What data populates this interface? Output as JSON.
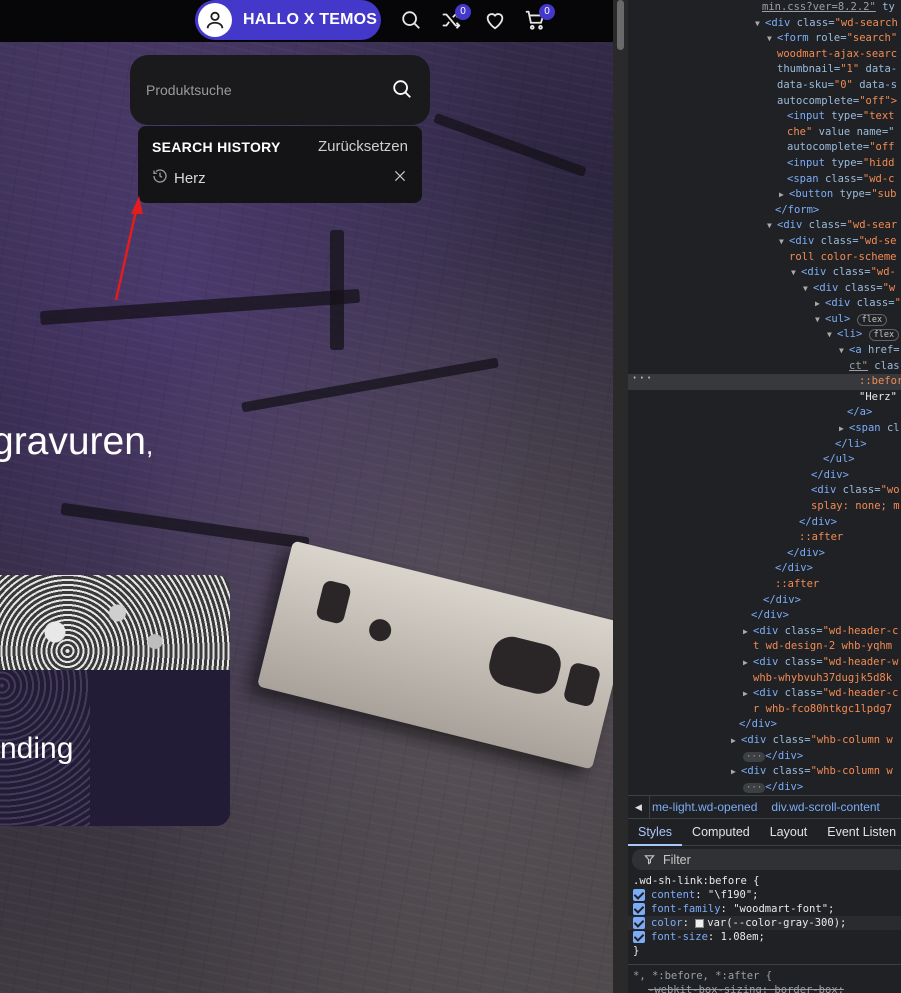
{
  "site": {
    "account": {
      "label": "HALLO X TEMOS"
    },
    "compare_count": "0",
    "cart_count": "0",
    "search": {
      "placeholder": "Produktsuche"
    },
    "history": {
      "title": "SEARCH HISTORY",
      "reset_label": "Zurücksetzen",
      "items": [
        {
          "label": "Herz"
        }
      ]
    },
    "hero_text_main": "gravuren",
    "hero_text_punct": ",",
    "card_text": "nding",
    "colors": {
      "accent": "#4338ca",
      "annotation_arrow": "#e11d1d"
    }
  },
  "devtools": {
    "dom": {
      "l0": "min.css?ver=8.2.2\"",
      "l0b": "ty",
      "l1_tag": "div",
      "l1_attr": "class=",
      "l1_val": "\"wd-search",
      "l2_tag": "form",
      "l2_attr": "role=",
      "l2_val": "\"search\"",
      "l3": "woodmart-ajax-searc",
      "l4a": "thumbnail=",
      "l4b": "\"1\"",
      "l4c": "data-",
      "l5a": "data-sku=",
      "l5b": "\"0\"",
      "l5c": "data-s",
      "l6a": "autocomplete=",
      "l6b": "\"off\">",
      "l7_tag": "input",
      "l7_attr": "type=",
      "l7_val": "\"text",
      "l8a": "che\"",
      "l8b": "value",
      "l8c": "name=\"",
      "l9a": "autocomplete=",
      "l9b": "\"off",
      "l10_tag": "input",
      "l10_attr": "type=",
      "l10_val": "\"hidd",
      "l11_tag": "span",
      "l11_attr": "class=",
      "l11_val": "\"wd-c",
      "l12_tag": "button",
      "l12_attr": "type=",
      "l12_val": "\"sub",
      "l13": "</form>",
      "l14_tag": "div",
      "l14_attr": "class=",
      "l14_val": "\"wd-sear",
      "l15_tag": "div",
      "l15_attr": "class=",
      "l15_val": "\"wd-se",
      "l16a": "roll",
      "l16b": "color-scheme",
      "l17_tag": "div",
      "l17_attr": "class=",
      "l17_val": "\"wd-",
      "l18_tag": "div",
      "l18_attr": "class=",
      "l18_val": "\"w",
      "l19_tag": "div",
      "l19_attr": "class=",
      "l19_val": "\"",
      "l20_tag": "ul",
      "pill_flex": "flex",
      "l21_tag": "li",
      "l22_tag": "a",
      "l22_attr": "href=",
      "l23a": "ct\"",
      "l23b": "clas",
      "l24": "::befor",
      "l25": "\"Herz\"",
      "l26": "</a>",
      "l27_tag": "span",
      "l27_attr": "cl",
      "l28": "</li>",
      "l29": "</ul>",
      "l30": "</div>",
      "l31_tag": "div",
      "l31_attr": "class=",
      "l31_val": "\"wo",
      "l32a": "splay:",
      "l32b": "none;",
      "l32c": "m",
      "l33": "</div>",
      "l34": "::after",
      "l35": "</div>",
      "l36": "</div>",
      "l37": "::after",
      "l38": "</div>",
      "l39": "</div>",
      "l40_tag": "div",
      "l40_attr": "class=",
      "l40_val": "\"wd-header-c",
      "l41": "t wd-design-2 whb-yqhm",
      "l42_tag": "div",
      "l42_attr": "class=",
      "l42_val": "\"wd-header-w",
      "l43": "whb-whybvuh37dugjk5d8k",
      "l44_tag": "div",
      "l44_attr": "class=",
      "l44_val": "\"wd-header-c",
      "l45": "r whb-fco80htkgc1lpdg7",
      "l46": "</div>",
      "l47_tag": "div",
      "l47_attr": "class=",
      "l47_val": "\"whb-column w",
      "ellipsis": "···",
      "l48": "</div>",
      "l49_tag": "div",
      "l49_attr": "class=",
      "l49_val": "\"whb-column w",
      "l50": "</div>",
      "gutter": "···"
    },
    "breadcrumbs": [
      "me-light.wd-opened",
      "div.wd-scroll-content"
    ],
    "tabs": [
      "Styles",
      "Computed",
      "Layout",
      "Event Listen"
    ],
    "filter_placeholder": "Filter",
    "styles": {
      "selector": ".wd-sh-link:before {",
      "decls": [
        {
          "prop": "content",
          "value": "\"\\f190\";"
        },
        {
          "prop": "font-family",
          "value": "\"woodmart-font\";"
        },
        {
          "prop": "color",
          "value": "var(--color-gray-300);"
        },
        {
          "prop": "font-size",
          "value": "1.08em;"
        }
      ],
      "close": "}",
      "selector2": "*, *:before, *:after {",
      "decl2": "-webkit-box-sizing: border-box;"
    }
  }
}
